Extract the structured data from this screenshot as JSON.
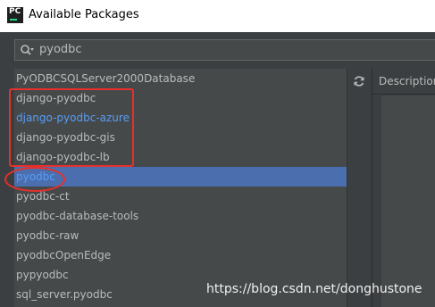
{
  "window": {
    "title": "Available Packages",
    "app_icon_text": "PC",
    "app_icon": "pycharm-icon"
  },
  "search": {
    "value": "pyodbc",
    "icon": "search-icon"
  },
  "packages": {
    "items": [
      {
        "name": "PyODBCSQLServer2000Database"
      },
      {
        "name": "django-pyodbc"
      },
      {
        "name": "django-pyodbc-azure",
        "highlighted": true
      },
      {
        "name": "django-pyodbc-gis"
      },
      {
        "name": "django-pyodbc-lb"
      },
      {
        "name": "pyodbc",
        "selected": true
      },
      {
        "name": "pyodbc-ct"
      },
      {
        "name": "pyodbc-database-tools"
      },
      {
        "name": "pyodbc-raw"
      },
      {
        "name": "pyodbcOpenEdge"
      },
      {
        "name": "pypyodbc"
      },
      {
        "name": "sql_server.pyodbc"
      }
    ],
    "selected_index": 5
  },
  "toolbar": {
    "refresh_icon": "refresh-icon"
  },
  "description": {
    "header": "Description"
  },
  "watermark": {
    "text": "https://blog.csdn.net/donghustone"
  },
  "colors": {
    "annotation": "#e8302a",
    "selection": "#4b6eaf",
    "link": "#589df6"
  }
}
